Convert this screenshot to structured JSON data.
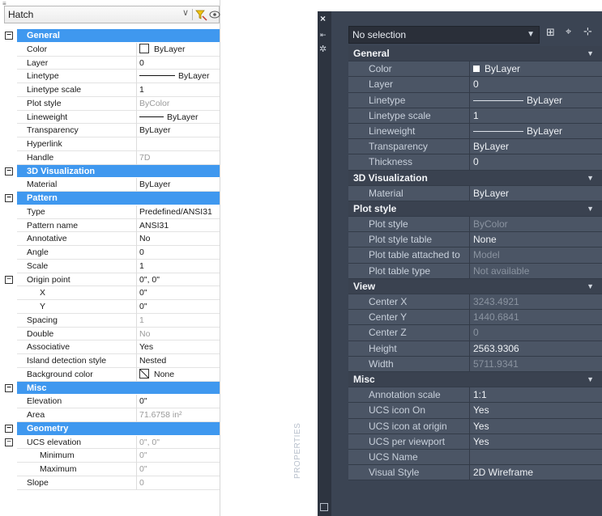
{
  "light": {
    "dropdown": "Hatch",
    "groups": [
      {
        "title": "General",
        "rows": [
          {
            "name": "Color",
            "value": "ByLayer",
            "kind": "swatch"
          },
          {
            "name": "Layer",
            "value": "0"
          },
          {
            "name": "Linetype",
            "value": "ByLayer",
            "kind": "line"
          },
          {
            "name": "Linetype scale",
            "value": "1"
          },
          {
            "name": "Plot style",
            "value": "ByColor",
            "grey": true
          },
          {
            "name": "Lineweight",
            "value": "ByLayer",
            "kind": "line"
          },
          {
            "name": "Transparency",
            "value": "ByLayer"
          },
          {
            "name": "Hyperlink",
            "value": ""
          },
          {
            "name": "Handle",
            "value": "7D",
            "grey": true
          }
        ]
      },
      {
        "title": "3D Visualization",
        "rows": [
          {
            "name": "Material",
            "value": "ByLayer"
          }
        ]
      },
      {
        "title": "Pattern",
        "rows": [
          {
            "name": "Type",
            "value": "Predefined/ANSI31"
          },
          {
            "name": "Pattern name",
            "value": "ANSI31"
          },
          {
            "name": "Annotative",
            "value": "No"
          },
          {
            "name": "Angle",
            "value": "0"
          },
          {
            "name": "Scale",
            "value": "1"
          },
          {
            "name": "Origin point",
            "value": "0\", 0\"",
            "box": true
          },
          {
            "name": "X",
            "value": "0\"",
            "sub": true
          },
          {
            "name": "Y",
            "value": "0\"",
            "sub": true
          },
          {
            "name": "Spacing",
            "value": "1",
            "grey": true
          },
          {
            "name": "Double",
            "value": "No",
            "grey": true
          },
          {
            "name": "Associative",
            "value": "Yes"
          },
          {
            "name": "Island detection style",
            "value": "Nested"
          },
          {
            "name": "Background color",
            "value": "None",
            "kind": "noneswatch"
          }
        ]
      },
      {
        "title": "Misc",
        "rows": [
          {
            "name": "Elevation",
            "value": "0\""
          },
          {
            "name": "Area",
            "value": "71.6758 in²",
            "grey": true
          }
        ]
      },
      {
        "title": "Geometry",
        "rows": [
          {
            "name": "UCS elevation",
            "value": "0\", 0\"",
            "grey": true,
            "box": true
          },
          {
            "name": "Minimum",
            "value": "0\"",
            "grey": true,
            "sub": true
          },
          {
            "name": "Maximum",
            "value": "0\"",
            "grey": true,
            "sub": true
          },
          {
            "name": "Slope",
            "value": "0",
            "grey": true
          }
        ]
      }
    ]
  },
  "dark": {
    "dropdown": "No selection",
    "side_label": "PROPERTIES",
    "groups": [
      {
        "title": "General",
        "rows": [
          {
            "name": "Color",
            "value": "ByLayer",
            "kind": "swatch"
          },
          {
            "name": "Layer",
            "value": "0"
          },
          {
            "name": "Linetype",
            "value": "ByLayer",
            "kind": "line"
          },
          {
            "name": "Linetype scale",
            "value": "1"
          },
          {
            "name": "Lineweight",
            "value": "ByLayer",
            "kind": "line"
          },
          {
            "name": "Transparency",
            "value": "ByLayer"
          },
          {
            "name": "Thickness",
            "value": "0"
          }
        ]
      },
      {
        "title": "3D Visualization",
        "rows": [
          {
            "name": "Material",
            "value": "ByLayer"
          }
        ]
      },
      {
        "title": "Plot style",
        "rows": [
          {
            "name": "Plot style",
            "value": "ByColor",
            "grey": true
          },
          {
            "name": "Plot style table",
            "value": "None"
          },
          {
            "name": "Plot table attached to",
            "value": "Model",
            "grey": true
          },
          {
            "name": "Plot table type",
            "value": "Not available",
            "grey": true
          }
        ]
      },
      {
        "title": "View",
        "rows": [
          {
            "name": "Center X",
            "value": "3243.4921",
            "grey": true
          },
          {
            "name": "Center Y",
            "value": "1440.6841",
            "grey": true
          },
          {
            "name": "Center Z",
            "value": "0",
            "grey": true
          },
          {
            "name": "Height",
            "value": "2563.9306"
          },
          {
            "name": "Width",
            "value": "5711.9341",
            "grey": true
          }
        ]
      },
      {
        "title": "Misc",
        "rows": [
          {
            "name": "Annotation scale",
            "value": "1:1"
          },
          {
            "name": "UCS icon On",
            "value": "Yes"
          },
          {
            "name": "UCS icon at origin",
            "value": "Yes"
          },
          {
            "name": "UCS per viewport",
            "value": "Yes"
          },
          {
            "name": "UCS Name",
            "value": ""
          },
          {
            "name": "Visual Style",
            "value": "2D Wireframe"
          }
        ]
      }
    ]
  },
  "colors": {
    "light_header": "#3f98ef",
    "dark_bg": "#3b4453"
  }
}
